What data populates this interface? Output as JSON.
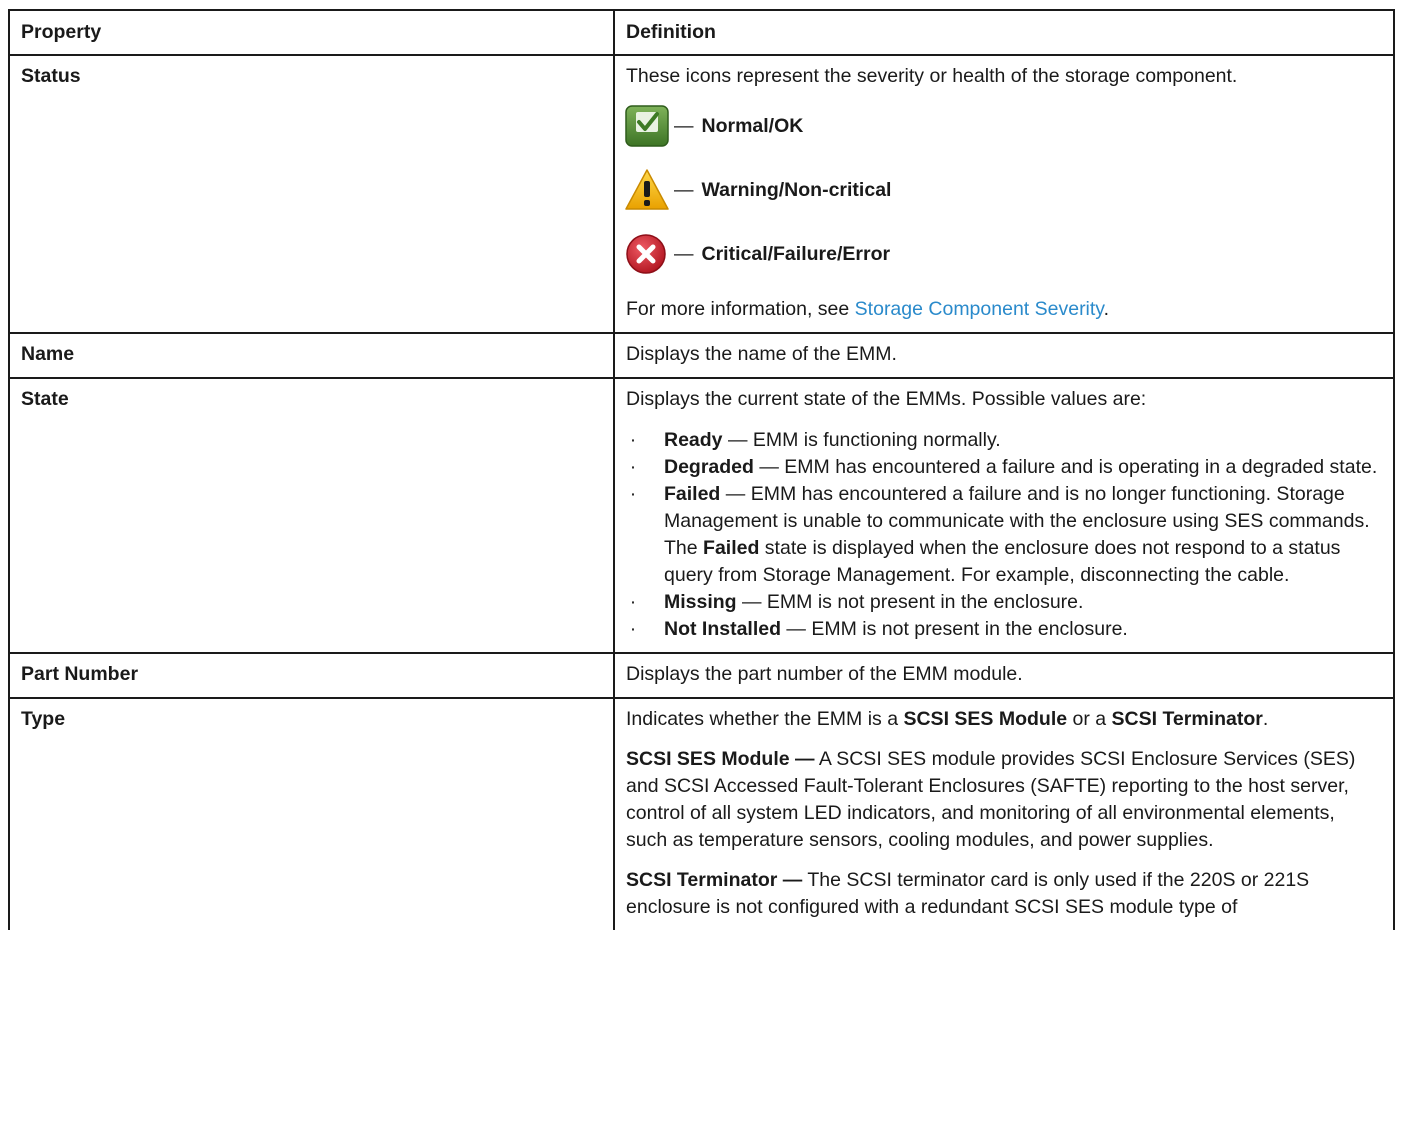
{
  "table": {
    "headers": {
      "property": "Property",
      "definition": "Definition"
    },
    "status": {
      "property": "Status",
      "intro": "These icons represent the severity or health of the storage component.",
      "dash": "—",
      "items": [
        {
          "icon": "check-icon",
          "label": "Normal/OK",
          "color": "#4f8a2f"
        },
        {
          "icon": "warning-icon",
          "label": "Warning/Non-critical",
          "color": "#f2b600"
        },
        {
          "icon": "critical-x-icon",
          "label": "Critical/Failure/Error",
          "color": "#d0232f"
        }
      ],
      "more_prefix": "For more information, see ",
      "more_link": "Storage Component Severity",
      "more_suffix": "."
    },
    "name": {
      "property": "Name",
      "definition": "Displays the name of the EMM."
    },
    "state": {
      "property": "State",
      "intro": "Displays the current state of the EMMs. Possible values are:",
      "bullet": "·",
      "items": [
        {
          "term": "Ready",
          "text": " — EMM is functioning normally."
        },
        {
          "term": "Degraded",
          "text": " — EMM has encountered a failure and is operating in a degraded state."
        },
        {
          "term": "Failed",
          "text": " — EMM has encountered a failure and is no longer functioning. Storage Management is unable to communicate with the enclosure using SES commands. The ",
          "term2": "Failed",
          "text2": " state is displayed when the enclosure does not respond to a status query from Storage Management. For example, disconnecting the cable."
        },
        {
          "term": "Missing",
          "text": " — EMM is not present in the enclosure."
        },
        {
          "term": "Not Installed",
          "text": " — EMM is not present in the enclosure."
        }
      ]
    },
    "part_number": {
      "property": "Part Number",
      "definition": "Displays the part number of the EMM module."
    },
    "type": {
      "property": "Type",
      "p1_a": "Indicates whether the EMM is a ",
      "p1_b": "SCSI SES Module",
      "p1_c": " or a ",
      "p1_d": "SCSI Terminator",
      "p1_e": ".",
      "p2_term": "SCSI SES Module —",
      "p2_text": " A SCSI SES module provides SCSI Enclosure Services (SES) and SCSI Accessed Fault-Tolerant Enclosures (SAFTE) reporting to the host server, control of all system LED indicators, and monitoring of all environmental elements, such as temperature sensors, cooling modules, and power supplies.",
      "p3_term": "SCSI Terminator —",
      "p3_text": " The SCSI terminator card is only used if the 220S or 221S enclosure is not configured with a redundant SCSI SES module type of"
    }
  }
}
